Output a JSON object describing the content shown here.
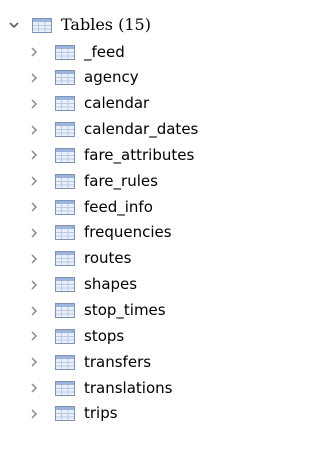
{
  "tree": {
    "root": {
      "label": "Tables (15)",
      "expanded": true,
      "icon": "table-icon",
      "chevron_icon": "chevron-down-icon"
    },
    "items": [
      {
        "label": "_feed",
        "icon": "table-icon",
        "chevron_icon": "chevron-right-icon"
      },
      {
        "label": "agency",
        "icon": "table-icon",
        "chevron_icon": "chevron-right-icon"
      },
      {
        "label": "calendar",
        "icon": "table-icon",
        "chevron_icon": "chevron-right-icon"
      },
      {
        "label": "calendar_dates",
        "icon": "table-icon",
        "chevron_icon": "chevron-right-icon"
      },
      {
        "label": "fare_attributes",
        "icon": "table-icon",
        "chevron_icon": "chevron-right-icon"
      },
      {
        "label": "fare_rules",
        "icon": "table-icon",
        "chevron_icon": "chevron-right-icon"
      },
      {
        "label": "feed_info",
        "icon": "table-icon",
        "chevron_icon": "chevron-right-icon"
      },
      {
        "label": "frequencies",
        "icon": "table-icon",
        "chevron_icon": "chevron-right-icon"
      },
      {
        "label": "routes",
        "icon": "table-icon",
        "chevron_icon": "chevron-right-icon"
      },
      {
        "label": "shapes",
        "icon": "table-icon",
        "chevron_icon": "chevron-right-icon"
      },
      {
        "label": "stop_times",
        "icon": "table-icon",
        "chevron_icon": "chevron-right-icon"
      },
      {
        "label": "stops",
        "icon": "table-icon",
        "chevron_icon": "chevron-right-icon"
      },
      {
        "label": "transfers",
        "icon": "table-icon",
        "chevron_icon": "chevron-right-icon"
      },
      {
        "label": "translations",
        "icon": "table-icon",
        "chevron_icon": "chevron-right-icon"
      },
      {
        "label": "trips",
        "icon": "table-icon",
        "chevron_icon": "chevron-right-icon"
      }
    ]
  },
  "colors": {
    "chevron": "#7a7a7a",
    "icon_border": "#7f93b8",
    "icon_header": "#9db5dd",
    "icon_fill": "#e9f0fb",
    "icon_grid": "#b9c9e4",
    "text": "#000000",
    "background": "#ffffff"
  }
}
